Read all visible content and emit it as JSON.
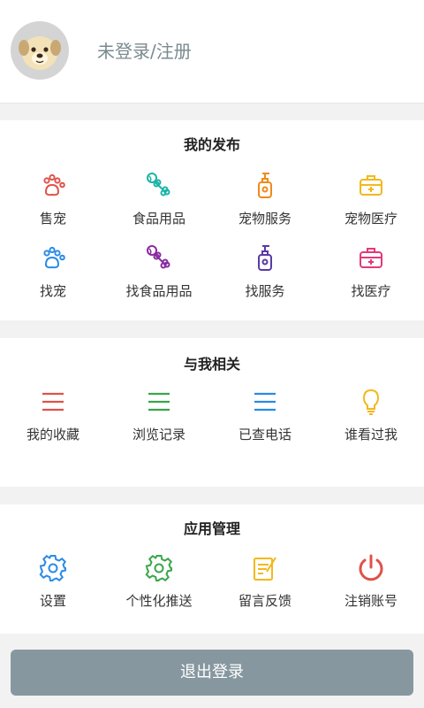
{
  "header": {
    "login_label": "未登录/注册"
  },
  "publish": {
    "title": "我的发布",
    "items": [
      {
        "label": "售宠",
        "icon": "paw-icon",
        "color": "#e0524a"
      },
      {
        "label": "食品用品",
        "icon": "bone-ball-icon",
        "color": "#1ab5a5"
      },
      {
        "label": "宠物服务",
        "icon": "shampoo-bottle-icon",
        "color": "#f08a1a"
      },
      {
        "label": "宠物医疗",
        "icon": "medical-kit-icon",
        "color": "#f3b81c"
      },
      {
        "label": "找宠",
        "icon": "paw-icon",
        "color": "#2a8be6"
      },
      {
        "label": "找食品用品",
        "icon": "bone-ball-icon",
        "color": "#8a2aa0"
      },
      {
        "label": "找服务",
        "icon": "shampoo-bottle-icon",
        "color": "#5a3aa6"
      },
      {
        "label": "找医疗",
        "icon": "medical-kit-icon",
        "color": "#e23a7a"
      }
    ]
  },
  "related": {
    "title": "与我相关",
    "items": [
      {
        "label": "我的收藏",
        "icon": "list-icon",
        "color": "#e0524a"
      },
      {
        "label": "浏览记录",
        "icon": "list-icon",
        "color": "#3aa64a"
      },
      {
        "label": "已查电话",
        "icon": "list-icon",
        "color": "#2a8be6"
      },
      {
        "label": "谁看过我",
        "icon": "lightbulb-icon",
        "color": "#f3b81c"
      }
    ]
  },
  "manage": {
    "title": "应用管理",
    "items": [
      {
        "label": "设置",
        "icon": "gear-icon",
        "color": "#2a8be6"
      },
      {
        "label": "个性化推送",
        "icon": "gear-icon",
        "color": "#3aa64a"
      },
      {
        "label": "留言反馈",
        "icon": "edit-note-icon",
        "color": "#f3b81c"
      },
      {
        "label": "注销账号",
        "icon": "power-icon",
        "color": "#e0524a"
      }
    ]
  },
  "logout_label": "退出登录"
}
